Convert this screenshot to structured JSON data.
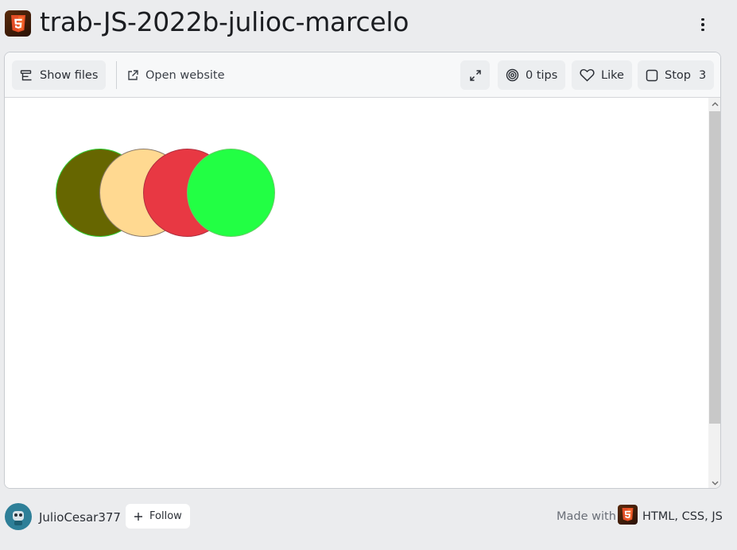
{
  "header": {
    "title": "trab-JS-2022b-julioc-marcelo",
    "logo_icon": "html5-icon",
    "menu_icon": "kebab-menu-icon"
  },
  "toolbar": {
    "show_files_label": "Show files",
    "open_website_label": "Open website",
    "fullscreen_icon": "expand-icon",
    "tips_label": "0 tips",
    "like_label": "Like",
    "stop_label": "Stop",
    "stop_count": "3"
  },
  "canvas": {
    "circles": [
      {
        "fill": "#666600",
        "stroke": "#33cc33"
      },
      {
        "fill": "#ffd991",
        "stroke": "#8a7a6a"
      },
      {
        "fill": "#e83843",
        "stroke": "#b03040"
      },
      {
        "fill": "#22ff44",
        "stroke": "#66cc66"
      }
    ]
  },
  "footer": {
    "username": "JulioCesar377",
    "follow_label": "Follow",
    "made_with_label": "Made with",
    "languages": "HTML, CSS, JS"
  },
  "colors": {
    "background": "#ebecee",
    "html5_brand": "#e44d26"
  }
}
